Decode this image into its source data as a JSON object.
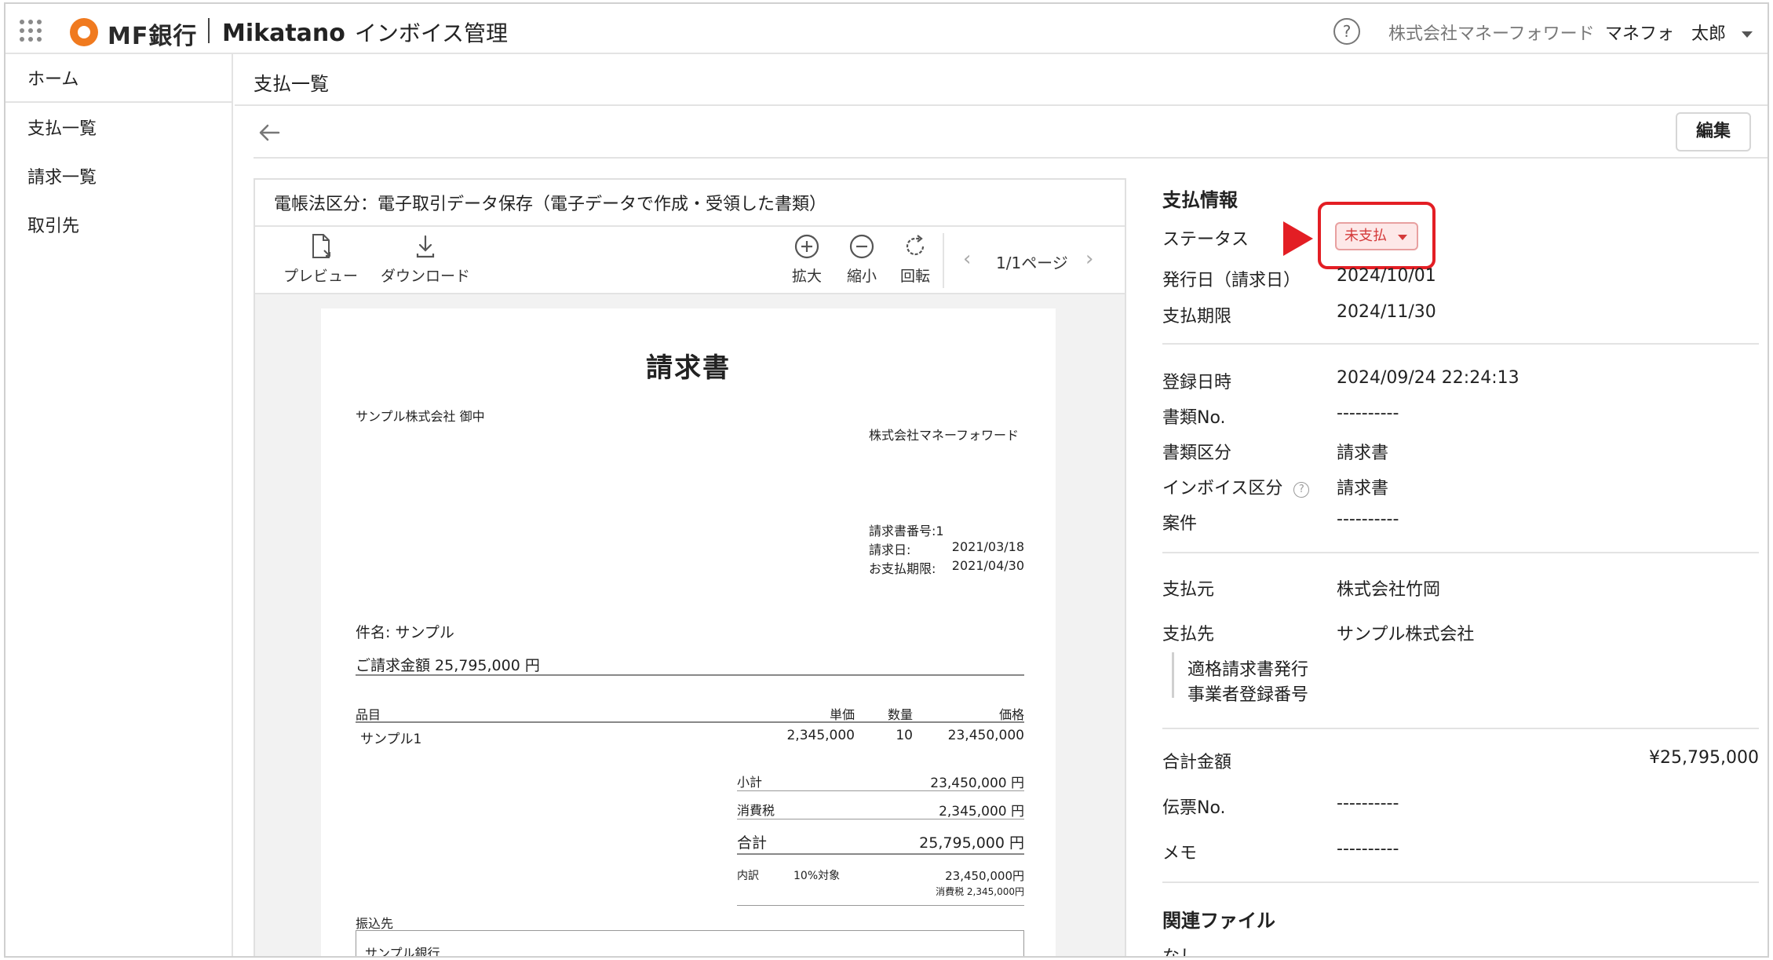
{
  "header": {
    "bank_name": "MF銀行",
    "app_brand": "Mikatano",
    "app_sub": "インボイス管理",
    "company": "株式会社マネーフォワード",
    "user": "マネフォ　太郎"
  },
  "sidebar": {
    "items": [
      {
        "label": "ホーム"
      },
      {
        "label": "支払一覧"
      },
      {
        "label": "請求一覧"
      },
      {
        "label": "取引先"
      }
    ]
  },
  "page": {
    "title": "支払一覧",
    "edit_label": "編集"
  },
  "viewer": {
    "header": "電帳法区分：電子取引データ保存（電子データで作成・受領した書類）",
    "tools": {
      "preview": "プレビュー",
      "download": "ダウンロード",
      "zoom_in": "拡大",
      "zoom_out": "縮小",
      "rotate": "回転"
    },
    "pager": "1/1ページ"
  },
  "document": {
    "title": "請求書",
    "recipient": "サンプル株式会社 御中",
    "issuer": "株式会社マネーフォワード",
    "invoice_no": "請求書番号:1",
    "invoice_date_label": "請求日:",
    "invoice_date": "2021/03/18",
    "due_label": "お支払期限:",
    "due_date": "2021/04/30",
    "subject": "件名: サンプル",
    "amount_line": "ご請求金額 25,795,000 円",
    "table": {
      "headers": [
        "品目",
        "単価",
        "数量",
        "価格"
      ],
      "rows": [
        [
          "サンプル1",
          "2,345,000",
          "10",
          "23,450,000"
        ]
      ]
    },
    "subtotal_label": "小計",
    "subtotal": "23,450,000 円",
    "tax_label": "消費税",
    "tax": "2,345,000 円",
    "total_label": "合計",
    "total": "25,795,000 円",
    "breakdown_label": "内訳",
    "breakdown_target": "10%対象",
    "breakdown_amount": "23,450,000円",
    "breakdown_tax": "消費税 2,345,000円",
    "bank_section": "振込先",
    "bank_name": "サンプル銀行"
  },
  "info": {
    "section_title": "支払情報",
    "status_label": "ステータス",
    "status_value": "未支払",
    "issue_date_label": "発行日（請求日）",
    "issue_date": "2024/10/01",
    "due_label": "支払期限",
    "due_date": "2024/11/30",
    "registered_label": "登録日時",
    "registered": "2024/09/24 22:24:13",
    "doc_no_label": "書類No.",
    "doc_no": "----------",
    "doc_type_label": "書類区分",
    "doc_type": "請求書",
    "invoice_type_label": "インボイス区分",
    "invoice_type": "請求書",
    "project_label": "案件",
    "project": "----------",
    "payer_label": "支払元",
    "payer": "株式会社竹岡",
    "payee_label": "支払先",
    "payee": "サンプル株式会社",
    "qualified_line1": "適格請求書発行",
    "qualified_line2": "事業者登録番号",
    "total_label": "合計金額",
    "total": "¥25,795,000",
    "voucher_label": "伝票No.",
    "voucher": "----------",
    "memo_label": "メモ",
    "memo": "----------",
    "files_title": "関連ファイル",
    "files_value": "なし"
  },
  "colors": {
    "brand_orange": "#f07a1f",
    "status_red": "#e31e24",
    "status_badge_bg": "#fde8e8"
  }
}
